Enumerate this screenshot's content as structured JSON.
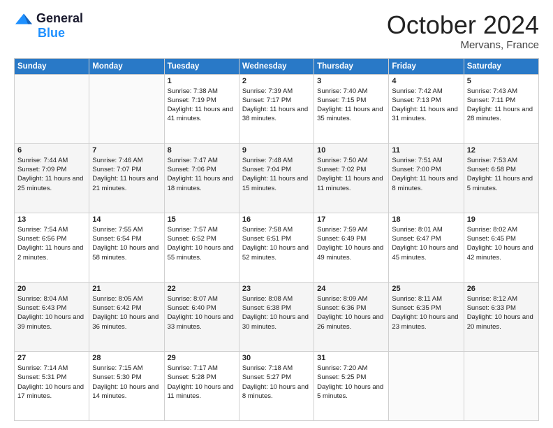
{
  "header": {
    "logo_line1": "General",
    "logo_line2": "Blue",
    "month": "October 2024",
    "location": "Mervans, France"
  },
  "weekdays": [
    "Sunday",
    "Monday",
    "Tuesday",
    "Wednesday",
    "Thursday",
    "Friday",
    "Saturday"
  ],
  "weeks": [
    [
      {
        "num": "",
        "sunrise": "",
        "sunset": "",
        "daylight": ""
      },
      {
        "num": "",
        "sunrise": "",
        "sunset": "",
        "daylight": ""
      },
      {
        "num": "1",
        "sunrise": "Sunrise: 7:38 AM",
        "sunset": "Sunset: 7:19 PM",
        "daylight": "Daylight: 11 hours and 41 minutes."
      },
      {
        "num": "2",
        "sunrise": "Sunrise: 7:39 AM",
        "sunset": "Sunset: 7:17 PM",
        "daylight": "Daylight: 11 hours and 38 minutes."
      },
      {
        "num": "3",
        "sunrise": "Sunrise: 7:40 AM",
        "sunset": "Sunset: 7:15 PM",
        "daylight": "Daylight: 11 hours and 35 minutes."
      },
      {
        "num": "4",
        "sunrise": "Sunrise: 7:42 AM",
        "sunset": "Sunset: 7:13 PM",
        "daylight": "Daylight: 11 hours and 31 minutes."
      },
      {
        "num": "5",
        "sunrise": "Sunrise: 7:43 AM",
        "sunset": "Sunset: 7:11 PM",
        "daylight": "Daylight: 11 hours and 28 minutes."
      }
    ],
    [
      {
        "num": "6",
        "sunrise": "Sunrise: 7:44 AM",
        "sunset": "Sunset: 7:09 PM",
        "daylight": "Daylight: 11 hours and 25 minutes."
      },
      {
        "num": "7",
        "sunrise": "Sunrise: 7:46 AM",
        "sunset": "Sunset: 7:07 PM",
        "daylight": "Daylight: 11 hours and 21 minutes."
      },
      {
        "num": "8",
        "sunrise": "Sunrise: 7:47 AM",
        "sunset": "Sunset: 7:06 PM",
        "daylight": "Daylight: 11 hours and 18 minutes."
      },
      {
        "num": "9",
        "sunrise": "Sunrise: 7:48 AM",
        "sunset": "Sunset: 7:04 PM",
        "daylight": "Daylight: 11 hours and 15 minutes."
      },
      {
        "num": "10",
        "sunrise": "Sunrise: 7:50 AM",
        "sunset": "Sunset: 7:02 PM",
        "daylight": "Daylight: 11 hours and 11 minutes."
      },
      {
        "num": "11",
        "sunrise": "Sunrise: 7:51 AM",
        "sunset": "Sunset: 7:00 PM",
        "daylight": "Daylight: 11 hours and 8 minutes."
      },
      {
        "num": "12",
        "sunrise": "Sunrise: 7:53 AM",
        "sunset": "Sunset: 6:58 PM",
        "daylight": "Daylight: 11 hours and 5 minutes."
      }
    ],
    [
      {
        "num": "13",
        "sunrise": "Sunrise: 7:54 AM",
        "sunset": "Sunset: 6:56 PM",
        "daylight": "Daylight: 11 hours and 2 minutes."
      },
      {
        "num": "14",
        "sunrise": "Sunrise: 7:55 AM",
        "sunset": "Sunset: 6:54 PM",
        "daylight": "Daylight: 10 hours and 58 minutes."
      },
      {
        "num": "15",
        "sunrise": "Sunrise: 7:57 AM",
        "sunset": "Sunset: 6:52 PM",
        "daylight": "Daylight: 10 hours and 55 minutes."
      },
      {
        "num": "16",
        "sunrise": "Sunrise: 7:58 AM",
        "sunset": "Sunset: 6:51 PM",
        "daylight": "Daylight: 10 hours and 52 minutes."
      },
      {
        "num": "17",
        "sunrise": "Sunrise: 7:59 AM",
        "sunset": "Sunset: 6:49 PM",
        "daylight": "Daylight: 10 hours and 49 minutes."
      },
      {
        "num": "18",
        "sunrise": "Sunrise: 8:01 AM",
        "sunset": "Sunset: 6:47 PM",
        "daylight": "Daylight: 10 hours and 45 minutes."
      },
      {
        "num": "19",
        "sunrise": "Sunrise: 8:02 AM",
        "sunset": "Sunset: 6:45 PM",
        "daylight": "Daylight: 10 hours and 42 minutes."
      }
    ],
    [
      {
        "num": "20",
        "sunrise": "Sunrise: 8:04 AM",
        "sunset": "Sunset: 6:43 PM",
        "daylight": "Daylight: 10 hours and 39 minutes."
      },
      {
        "num": "21",
        "sunrise": "Sunrise: 8:05 AM",
        "sunset": "Sunset: 6:42 PM",
        "daylight": "Daylight: 10 hours and 36 minutes."
      },
      {
        "num": "22",
        "sunrise": "Sunrise: 8:07 AM",
        "sunset": "Sunset: 6:40 PM",
        "daylight": "Daylight: 10 hours and 33 minutes."
      },
      {
        "num": "23",
        "sunrise": "Sunrise: 8:08 AM",
        "sunset": "Sunset: 6:38 PM",
        "daylight": "Daylight: 10 hours and 30 minutes."
      },
      {
        "num": "24",
        "sunrise": "Sunrise: 8:09 AM",
        "sunset": "Sunset: 6:36 PM",
        "daylight": "Daylight: 10 hours and 26 minutes."
      },
      {
        "num": "25",
        "sunrise": "Sunrise: 8:11 AM",
        "sunset": "Sunset: 6:35 PM",
        "daylight": "Daylight: 10 hours and 23 minutes."
      },
      {
        "num": "26",
        "sunrise": "Sunrise: 8:12 AM",
        "sunset": "Sunset: 6:33 PM",
        "daylight": "Daylight: 10 hours and 20 minutes."
      }
    ],
    [
      {
        "num": "27",
        "sunrise": "Sunrise: 7:14 AM",
        "sunset": "Sunset: 5:31 PM",
        "daylight": "Daylight: 10 hours and 17 minutes."
      },
      {
        "num": "28",
        "sunrise": "Sunrise: 7:15 AM",
        "sunset": "Sunset: 5:30 PM",
        "daylight": "Daylight: 10 hours and 14 minutes."
      },
      {
        "num": "29",
        "sunrise": "Sunrise: 7:17 AM",
        "sunset": "Sunset: 5:28 PM",
        "daylight": "Daylight: 10 hours and 11 minutes."
      },
      {
        "num": "30",
        "sunrise": "Sunrise: 7:18 AM",
        "sunset": "Sunset: 5:27 PM",
        "daylight": "Daylight: 10 hours and 8 minutes."
      },
      {
        "num": "31",
        "sunrise": "Sunrise: 7:20 AM",
        "sunset": "Sunset: 5:25 PM",
        "daylight": "Daylight: 10 hours and 5 minutes."
      },
      {
        "num": "",
        "sunrise": "",
        "sunset": "",
        "daylight": ""
      },
      {
        "num": "",
        "sunrise": "",
        "sunset": "",
        "daylight": ""
      }
    ]
  ]
}
